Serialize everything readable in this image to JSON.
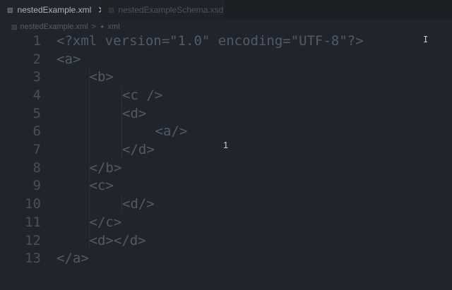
{
  "tabs": [
    {
      "label": "nestedExample.xml",
      "icon": "xml-file-icon",
      "close": "✕"
    },
    {
      "label": "nestedExampleSchema.xsd",
      "icon": "xsd-file-icon"
    }
  ],
  "breadcrumb": {
    "file": "nestedExample.xml",
    "separator": ">",
    "node": "xml"
  },
  "editor": {
    "lines": [
      {
        "number": "1",
        "indent": 0,
        "text": "<?xml version=\"1.0\" encoding=\"UTF-8\"?>"
      },
      {
        "number": "2",
        "indent": 0,
        "text": "<a>"
      },
      {
        "number": "3",
        "indent": 1,
        "text": "<b>"
      },
      {
        "number": "4",
        "indent": 2,
        "text": "<c />"
      },
      {
        "number": "5",
        "indent": 2,
        "text": "<d>"
      },
      {
        "number": "6",
        "indent": 3,
        "text": "<a/>"
      },
      {
        "number": "7",
        "indent": 2,
        "text": "</d>"
      },
      {
        "number": "8",
        "indent": 1,
        "text": "</b>"
      },
      {
        "number": "9",
        "indent": 1,
        "text": "<c>"
      },
      {
        "number": "10",
        "indent": 2,
        "text": "<d/>"
      },
      {
        "number": "11",
        "indent": 1,
        "text": "</c>"
      },
      {
        "number": "12",
        "indent": 1,
        "text": "<d></d>"
      },
      {
        "number": "13",
        "indent": 0,
        "text": "</a>"
      }
    ]
  },
  "overlay": {
    "ibeam": "I",
    "floating_number": "1"
  },
  "colors": {
    "background": "#21252b",
    "tab_active": "#21252b",
    "tab_inactive": "#1f2227",
    "text_dim": "#4f5b6b",
    "line_number": "#4a4f58"
  }
}
